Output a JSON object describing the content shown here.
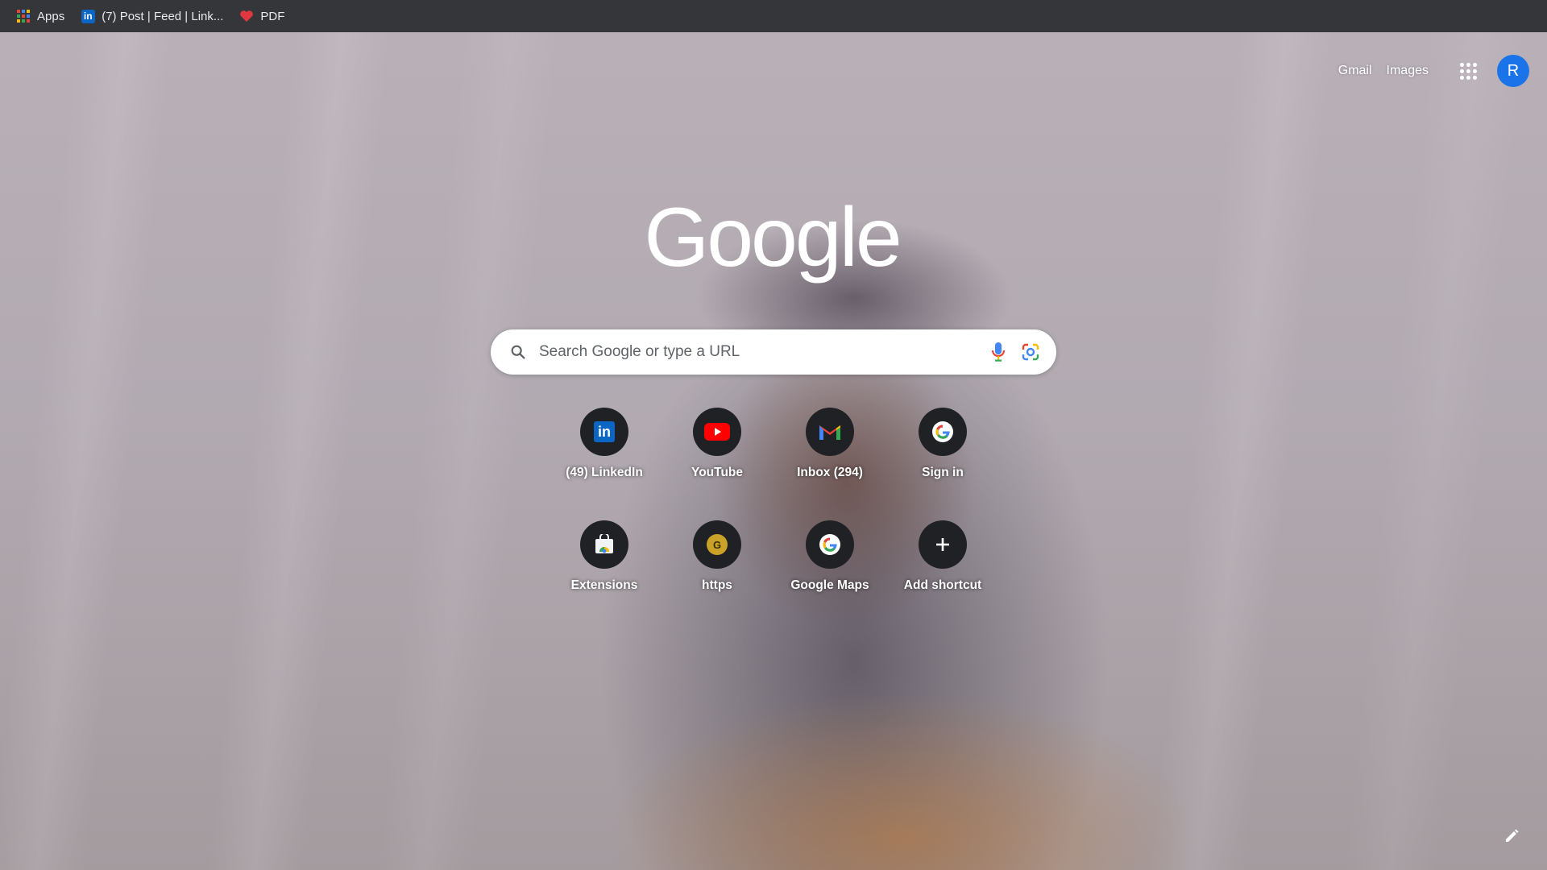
{
  "bookmarks": [
    {
      "label": "Apps",
      "icon": "apps-grid-icon"
    },
    {
      "label": "(7) Post | Feed | Link...",
      "icon": "linkedin-icon"
    },
    {
      "label": "PDF",
      "icon": "heart-icon"
    }
  ],
  "header": {
    "gmail": "Gmail",
    "images": "Images",
    "avatar_initial": "R",
    "avatar_color": "#1a73e8"
  },
  "logo": {
    "text": "Google"
  },
  "search": {
    "placeholder": "Search Google or type a URL"
  },
  "shortcuts": [
    {
      "label": "(49) LinkedIn",
      "icon": "linkedin-icon"
    },
    {
      "label": "YouTube",
      "icon": "youtube-icon"
    },
    {
      "label": "Inbox (294)",
      "icon": "gmail-icon"
    },
    {
      "label": "Sign in",
      "icon": "google-icon"
    },
    {
      "label": "Extensions",
      "icon": "chrome-web-store-icon"
    },
    {
      "label": "https",
      "icon": "generic-g-icon",
      "badge_letter": "G"
    },
    {
      "label": "Google Maps",
      "icon": "google-icon"
    },
    {
      "label": "Add shortcut",
      "icon": "plus-icon"
    }
  ],
  "colors": {
    "bookmarks_bar": "#35363a",
    "tile_bg": "#202124"
  }
}
